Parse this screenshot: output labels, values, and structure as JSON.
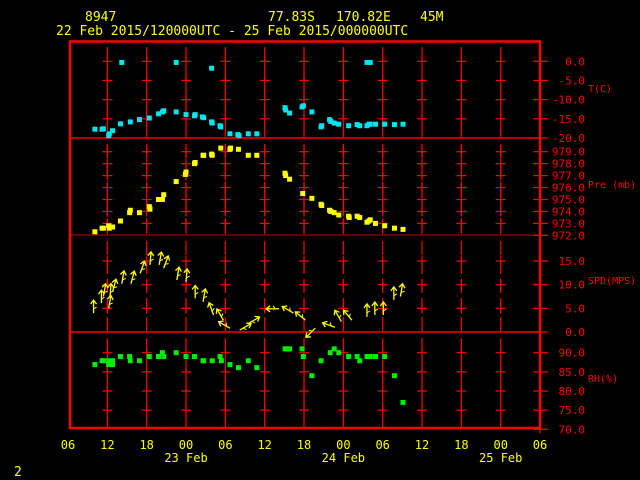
{
  "header": {
    "station_id": "8947",
    "latitude": "77.83S",
    "longitude": "170.82E",
    "elevation": "45M",
    "time_range": "22 Feb 2015/120000UTC - 25 Feb 2015/000000UTC"
  },
  "footer": {
    "page_number": "2"
  },
  "colors": {
    "frame": "#ff0000",
    "label": "#ff0000",
    "text": "#ffff00",
    "temperature": "#00e5ee",
    "pressure": "#ffff00",
    "wind": "#ffff00",
    "humidity": "#00ee00",
    "background": "#000000"
  },
  "chart_data": {
    "type": "scatter",
    "title": "8947 77.83S 170.82E 45M",
    "subtitle": "22 Feb 2015/120000UTC - 25 Feb 2015/000000UTC",
    "x_unit": "hours since 22 Feb 2015 06UTC",
    "xlim": [
      0,
      72
    ],
    "x_tick_labels": [
      "06",
      "12",
      "18",
      "00",
      "06",
      "12",
      "18",
      "00",
      "06",
      "12",
      "18",
      "00",
      "06"
    ],
    "date_labels": [
      {
        "label": "23 Feb",
        "hour": 18
      },
      {
        "label": "24 Feb",
        "hour": 42
      },
      {
        "label": "25 Feb",
        "hour": 66
      }
    ],
    "grid": true,
    "panels": [
      {
        "name": "temperature",
        "ylabel": "T(C)",
        "ylim": [
          -20,
          0
        ],
        "ticks": [
          "0.0",
          "-5.0",
          "-10.0",
          "-15.0",
          "-20.0"
        ],
        "tick_values": [
          0,
          -5,
          -10,
          -15,
          -20
        ],
        "points": [
          [
            4.1,
            -17.7
          ],
          [
            5.2,
            -17.7
          ],
          [
            5.4,
            -17.6
          ],
          [
            6.2,
            -19.4
          ],
          [
            6.3,
            -18.9
          ],
          [
            6.8,
            -18.1
          ],
          [
            8.0,
            -16.3
          ],
          [
            9.5,
            -15.8
          ],
          [
            10.9,
            -15.2
          ],
          [
            12.4,
            -14.8
          ],
          [
            13.8,
            -13.7
          ],
          [
            14.4,
            -13.2
          ],
          [
            14.6,
            -12.9
          ],
          [
            16.5,
            -13.2
          ],
          [
            18.0,
            -13.9
          ],
          [
            19.3,
            -14.2
          ],
          [
            19.4,
            -13.9
          ],
          [
            20.5,
            -14.5
          ],
          [
            20.7,
            -14.7
          ],
          [
            21.9,
            -15.8
          ],
          [
            22.0,
            -16.1
          ],
          [
            23.2,
            -16.8
          ],
          [
            23.3,
            -17.1
          ],
          [
            24.7,
            -18.9
          ],
          [
            25.9,
            -19.1
          ],
          [
            26.1,
            -19.4
          ],
          [
            27.5,
            -18.9
          ],
          [
            28.8,
            -18.9
          ],
          [
            33.1,
            -12.1
          ],
          [
            33.2,
            -12.7
          ],
          [
            33.8,
            -13.5
          ],
          [
            35.7,
            -11.9
          ],
          [
            35.9,
            -11.6
          ],
          [
            37.2,
            -13.2
          ],
          [
            38.6,
            -17.1
          ],
          [
            38.7,
            -16.8
          ],
          [
            39.9,
            -15.2
          ],
          [
            40.1,
            -15.7
          ],
          [
            40.6,
            -16.1
          ],
          [
            41.3,
            -16.4
          ],
          [
            42.8,
            -16.8
          ],
          [
            44.1,
            -16.5
          ],
          [
            44.5,
            -16.8
          ],
          [
            45.6,
            -16.8
          ],
          [
            45.9,
            -16.4
          ],
          [
            46.1,
            -16.4
          ],
          [
            46.9,
            -16.4
          ],
          [
            48.3,
            -16.4
          ],
          [
            49.8,
            -16.5
          ],
          [
            51.1,
            -16.4
          ],
          [
            8.2,
            -0.3
          ],
          [
            16.5,
            -0.3
          ],
          [
            21.9,
            -1.8
          ],
          [
            45.6,
            -0.3
          ],
          [
            46.1,
            -0.3
          ]
        ]
      },
      {
        "name": "pressure",
        "ylabel": "Pre (mb)",
        "ylim": [
          972,
          980
        ],
        "ticks": [
          "979.0",
          "978.0",
          "977.0",
          "976.0",
          "975.0",
          "974.0",
          "973.0",
          "972.0"
        ],
        "tick_values": [
          979,
          978,
          977,
          976,
          975,
          974,
          973,
          972
        ],
        "points": [
          [
            4.1,
            972.3
          ],
          [
            5.2,
            972.6
          ],
          [
            5.4,
            972.6
          ],
          [
            6.2,
            972.8
          ],
          [
            6.3,
            972.6
          ],
          [
            6.8,
            972.7
          ],
          [
            8.0,
            973.2
          ],
          [
            9.4,
            973.9
          ],
          [
            9.5,
            974.1
          ],
          [
            10.9,
            973.9
          ],
          [
            12.4,
            974.4
          ],
          [
            12.5,
            974.2
          ],
          [
            13.8,
            975.0
          ],
          [
            14.4,
            975.0
          ],
          [
            14.6,
            975.4
          ],
          [
            16.5,
            976.5
          ],
          [
            17.9,
            977.1
          ],
          [
            18.0,
            977.3
          ],
          [
            19.3,
            978.0
          ],
          [
            19.4,
            978.1
          ],
          [
            20.6,
            978.7
          ],
          [
            20.7,
            978.7
          ],
          [
            21.9,
            978.8
          ],
          [
            22.0,
            978.7
          ],
          [
            23.3,
            979.3
          ],
          [
            24.7,
            979.2
          ],
          [
            24.8,
            979.3
          ],
          [
            26.0,
            979.2
          ],
          [
            27.5,
            978.7
          ],
          [
            28.8,
            978.7
          ],
          [
            33.1,
            977.2
          ],
          [
            33.2,
            977.0
          ],
          [
            33.8,
            976.7
          ],
          [
            35.8,
            975.5
          ],
          [
            37.2,
            975.1
          ],
          [
            38.6,
            974.6
          ],
          [
            38.7,
            974.5
          ],
          [
            39.9,
            974.1
          ],
          [
            40.1,
            974.0
          ],
          [
            40.6,
            973.9
          ],
          [
            41.3,
            973.7
          ],
          [
            42.8,
            973.6
          ],
          [
            42.9,
            973.5
          ],
          [
            44.1,
            973.6
          ],
          [
            44.5,
            973.5
          ],
          [
            45.6,
            973.1
          ],
          [
            45.9,
            973.2
          ],
          [
            46.1,
            973.3
          ],
          [
            46.9,
            973.0
          ],
          [
            48.3,
            972.8
          ],
          [
            49.8,
            972.6
          ],
          [
            51.1,
            972.5
          ]
        ]
      },
      {
        "name": "wind_speed",
        "ylabel": "SPD(MPS)",
        "ylim": [
          0,
          17
        ],
        "ticks": [
          "15.0",
          "10.0",
          "5.0",
          "0.0"
        ],
        "tick_values": [
          15,
          10,
          5,
          0
        ],
        "point_format": "[hour, speed, arrow_direction_deg]",
        "points": [
          [
            3.9,
            4.0,
            0
          ],
          [
            5.1,
            6.1,
            0
          ],
          [
            5.4,
            7.5,
            10
          ],
          [
            6.2,
            5.0,
            10
          ],
          [
            6.4,
            7.5,
            5
          ],
          [
            6.8,
            8.5,
            15
          ],
          [
            8.2,
            10.2,
            10
          ],
          [
            9.6,
            10.2,
            15
          ],
          [
            11.0,
            12.4,
            20
          ],
          [
            12.5,
            14.2,
            5
          ],
          [
            13.9,
            14.2,
            10
          ],
          [
            14.6,
            13.5,
            20
          ],
          [
            16.6,
            11.0,
            10
          ],
          [
            18.0,
            10.6,
            5
          ],
          [
            19.4,
            7.1,
            0
          ],
          [
            20.6,
            6.4,
            10
          ],
          [
            22.2,
            3.6,
            340
          ],
          [
            23.7,
            2.5,
            330
          ],
          [
            24.7,
            0.8,
            300
          ],
          [
            26.2,
            0.4,
            60
          ],
          [
            27.5,
            1.8,
            60
          ],
          [
            32.2,
            4.9,
            270
          ],
          [
            34.4,
            4.0,
            300
          ],
          [
            36.2,
            2.5,
            310
          ],
          [
            37.7,
            0.8,
            225
          ],
          [
            40.7,
            1.0,
            290
          ],
          [
            41.7,
            2.2,
            330
          ],
          [
            43.3,
            2.5,
            320
          ],
          [
            45.6,
            3.2,
            0
          ],
          [
            46.8,
            3.6,
            0
          ],
          [
            48.1,
            3.6,
            0
          ],
          [
            49.7,
            6.8,
            0
          ],
          [
            50.7,
            7.5,
            10
          ]
        ]
      },
      {
        "name": "relative_humidity",
        "ylabel": "RH(%)",
        "ylim": [
          70,
          92
        ],
        "ticks": [
          "90.0",
          "85.0",
          "80.0",
          "75.0",
          "70.0"
        ],
        "tick_values": [
          90,
          85,
          80,
          75,
          70
        ],
        "points": [
          [
            4.1,
            86.9
          ],
          [
            5.2,
            87.9
          ],
          [
            5.4,
            87.9
          ],
          [
            6.2,
            87.9
          ],
          [
            6.2,
            86.9
          ],
          [
            6.8,
            87.9
          ],
          [
            6.8,
            86.9
          ],
          [
            8.0,
            89.0
          ],
          [
            9.4,
            89.0
          ],
          [
            9.5,
            87.9
          ],
          [
            10.9,
            87.9
          ],
          [
            12.4,
            89.0
          ],
          [
            13.8,
            89.0
          ],
          [
            14.4,
            90.0
          ],
          [
            14.6,
            89.0
          ],
          [
            16.5,
            90.0
          ],
          [
            18.0,
            89.0
          ],
          [
            19.3,
            89.0
          ],
          [
            20.6,
            87.9
          ],
          [
            20.7,
            87.9
          ],
          [
            22.0,
            87.9
          ],
          [
            23.2,
            89.0
          ],
          [
            23.4,
            87.9
          ],
          [
            24.7,
            86.9
          ],
          [
            26.0,
            86.1
          ],
          [
            27.5,
            87.9
          ],
          [
            28.8,
            86.1
          ],
          [
            33.1,
            91.0
          ],
          [
            33.5,
            91.0
          ],
          [
            33.8,
            91.0
          ],
          [
            35.7,
            91.0
          ],
          [
            35.9,
            89.0
          ],
          [
            37.2,
            84.0
          ],
          [
            38.6,
            87.9
          ],
          [
            40.0,
            90.0
          ],
          [
            40.6,
            91.0
          ],
          [
            41.3,
            90.0
          ],
          [
            42.8,
            89.0
          ],
          [
            44.1,
            89.0
          ],
          [
            44.5,
            87.9
          ],
          [
            45.6,
            89.0
          ],
          [
            46.1,
            89.0
          ],
          [
            46.9,
            89.0
          ],
          [
            48.3,
            89.0
          ],
          [
            49.8,
            84.0
          ],
          [
            51.1,
            77.0
          ]
        ]
      }
    ]
  }
}
